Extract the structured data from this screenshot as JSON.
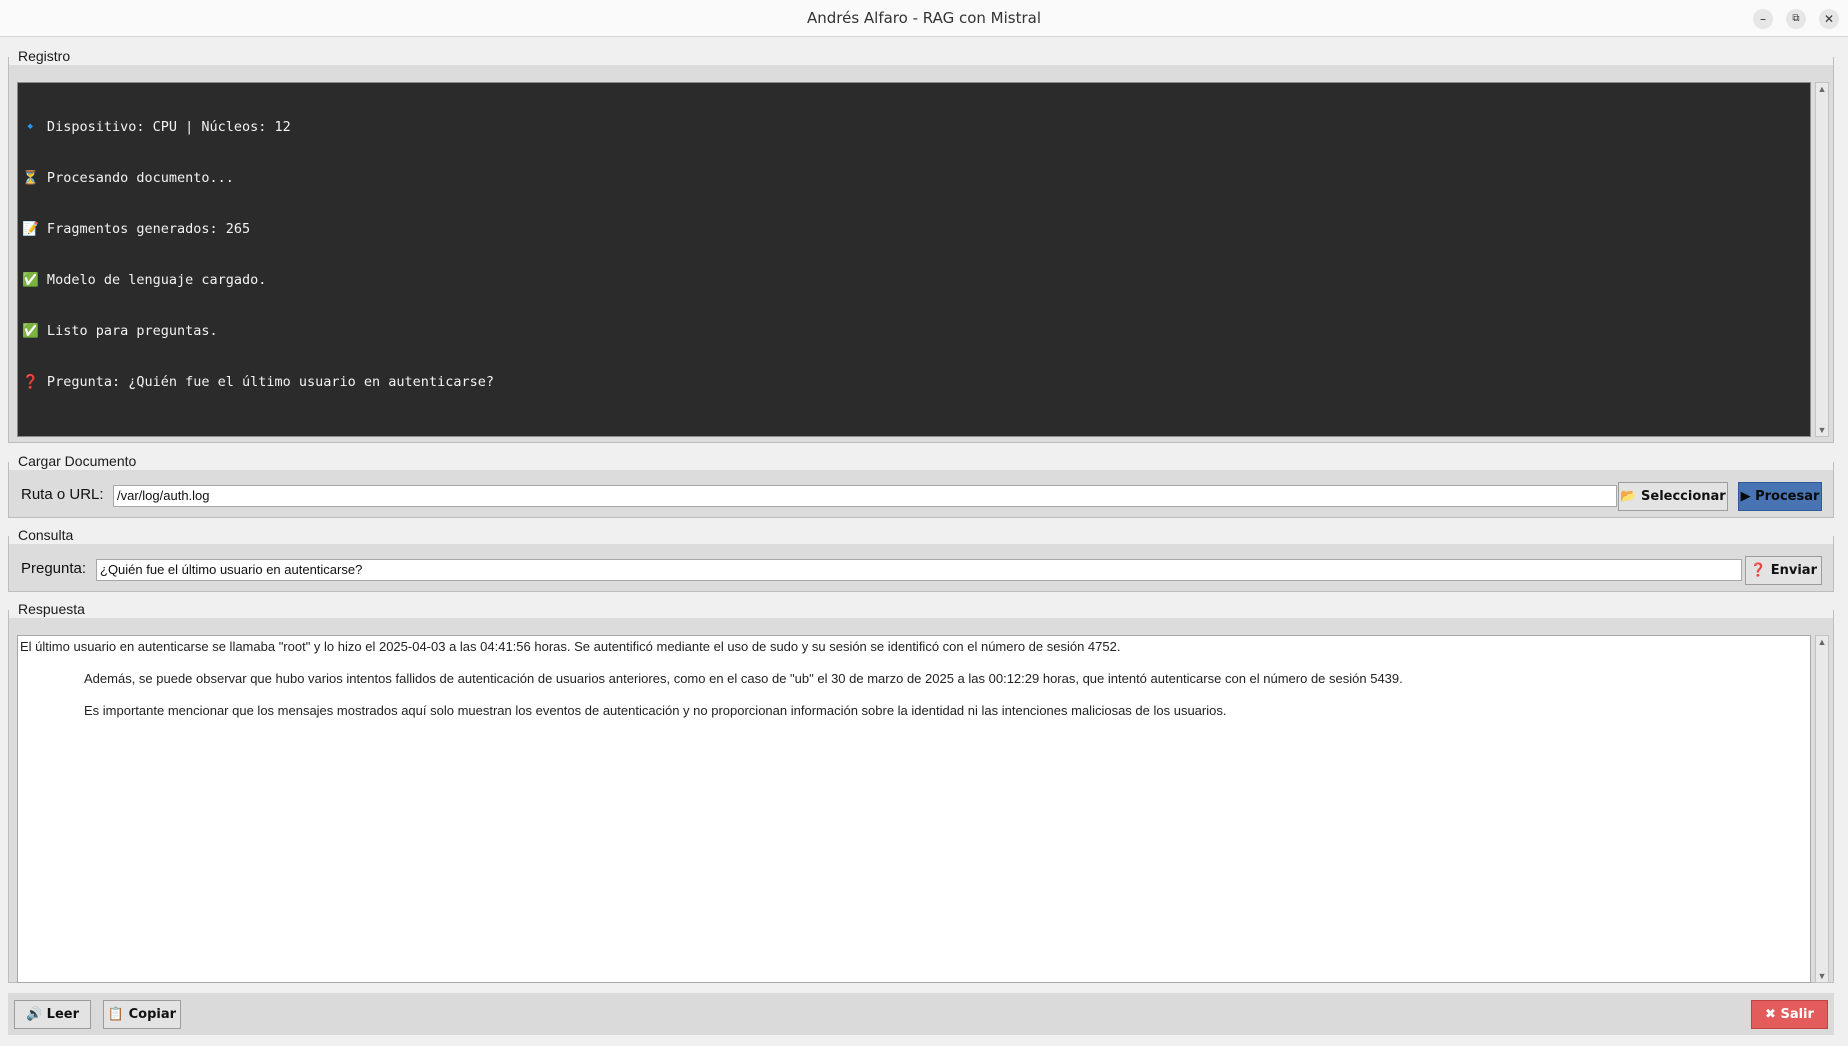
{
  "window": {
    "title": "Andrés Alfaro - RAG con Mistral",
    "minimize_icon": "minimize-icon",
    "maximize_icon": "maximize-icon",
    "close_icon": "close-icon"
  },
  "registro": {
    "legend": "Registro",
    "lines": [
      "🔹 Dispositivo: CPU | Núcleos: 12",
      "⏳ Procesando documento...",
      "📝 Fragmentos generados: 265",
      "✅ Modelo de lenguaje cargado.",
      "✅ Listo para preguntas.",
      "❓ Pregunta: ¿Quién fue el último usuario en autenticarse?"
    ]
  },
  "cargar": {
    "legend": "Cargar Documento",
    "label": "Ruta o URL:",
    "path_value": "/var/log/auth.log",
    "select_label": "📂 Seleccionar",
    "process_label": "▶ Procesar"
  },
  "consulta": {
    "legend": "Consulta",
    "label": "Pregunta:",
    "question_value": "¿Quién fue el último usuario en autenticarse?",
    "send_label": "❓ Enviar"
  },
  "respuesta": {
    "legend": "Respuesta",
    "paragraphs": [
      "El último usuario en autenticarse se llamaba \"root\" y lo hizo el 2025-04-03 a las 04:41:56 horas. Se autentificó mediante el uso de sudo y su sesión se identificó con el número de sesión 4752.",
      "Además, se puede observar que hubo varios intentos fallidos de autenticación de usuarios anteriores, como en el caso de \"ub\" el 30 de marzo de 2025 a las 00:12:29 horas, que intentó autenticarse con el número de sesión 5439.",
      "Es importante mencionar que los mensajes mostrados aquí solo muestran los eventos de autenticación y no proporcionan información sobre la identidad ni las intenciones maliciosas de los usuarios."
    ]
  },
  "actions": {
    "read_label": "🔊 Leer",
    "copy_label": "📋 Copiar",
    "exit_label": "✖ Salir"
  },
  "colors": {
    "log_background": "#2b2b2b",
    "process_button": "#4874b3",
    "exit_button": "#e35b5b"
  }
}
